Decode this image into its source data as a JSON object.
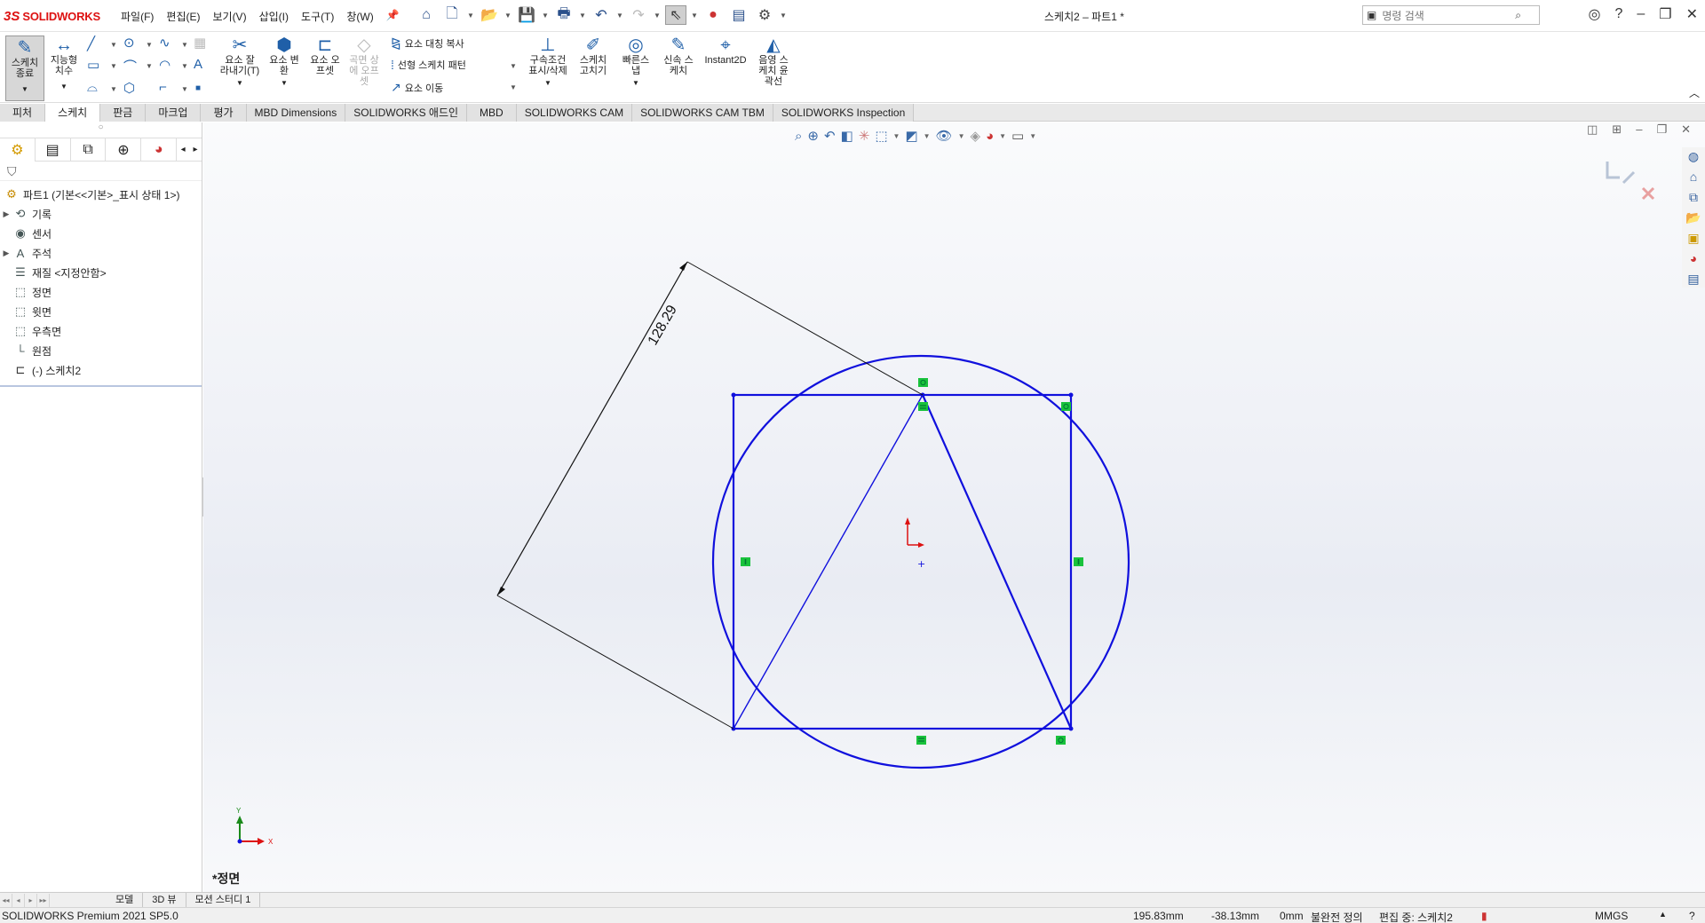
{
  "app": {
    "logo_ds": "3S",
    "logo_name": "SOLIDWORKS",
    "document_title": "스케치2 – 파트1 *",
    "colors": {
      "accent_red": "#d11111",
      "sketch_blue": "#1010dd",
      "relation_green": "#19c23c"
    }
  },
  "menu": [
    "파일(F)",
    "편집(E)",
    "보기(V)",
    "삽입(I)",
    "도구(T)",
    "창(W)"
  ],
  "search": {
    "placeholder": "명령 검색"
  },
  "commands": {
    "exit_sketch": "스케치\n종료",
    "smart_dimension": "지능형\n치수",
    "trim": "요소 잘\n라내기(T)",
    "convert": "요소 변\n환",
    "offset": "요소 오\n프셋",
    "surface_offset": "곡면 상\n에 오프\n셋",
    "mirror": "요소 대칭 복사",
    "linear_pattern": "선형 스케치 패턴",
    "move": "요소 이동",
    "relations": "구속조건\n표시/삭제",
    "repair": "스케치\n고치기",
    "quick_snaps": "빠른스\n냅",
    "rapid_sketch": "신속 스\n케치",
    "instant2d": "Instant2D",
    "shaded_contours": "음영 스\n케치 윤\n곽선"
  },
  "tabs": [
    "피처",
    "스케치",
    "판금",
    "마크업",
    "평가",
    "MBD Dimensions",
    "SOLIDWORKS 애드인",
    "MBD",
    "SOLIDWORKS CAM",
    "SOLIDWORKS CAM TBM",
    "SOLIDWORKS Inspection"
  ],
  "active_tab": "스케치",
  "tree": {
    "root": "파트1  (기본<<기본>_표시 상태 1>)",
    "items": [
      {
        "label": "기록",
        "expandable": true,
        "icon": "history-icon"
      },
      {
        "label": "센서",
        "expandable": false,
        "icon": "sensor-icon"
      },
      {
        "label": "주석",
        "expandable": true,
        "icon": "annotation-icon"
      },
      {
        "label": "재질 <지정안함>",
        "expandable": false,
        "icon": "material-icon"
      },
      {
        "label": "정면",
        "expandable": false,
        "icon": "plane-icon"
      },
      {
        "label": "윗면",
        "expandable": false,
        "icon": "plane-icon"
      },
      {
        "label": "우측면",
        "expandable": false,
        "icon": "plane-icon"
      },
      {
        "label": "원점",
        "expandable": false,
        "icon": "origin-icon"
      },
      {
        "label": "(-) 스케치2",
        "expandable": false,
        "icon": "sketch-icon"
      }
    ]
  },
  "graphics": {
    "dimension_value": "128.29",
    "view_label": "*정면",
    "axis_y": "Y",
    "axis_x": "X"
  },
  "model_tabs": [
    "모델",
    "3D 뷰",
    "모션 스터디 1"
  ],
  "status": {
    "version": "SOLIDWORKS Premium 2021 SP5.0",
    "x": "195.83mm",
    "y": "-38.13mm",
    "z": "0mm",
    "definition": "불완전 정의",
    "editing": "편집 중: 스케치2",
    "units": "MMGS"
  }
}
